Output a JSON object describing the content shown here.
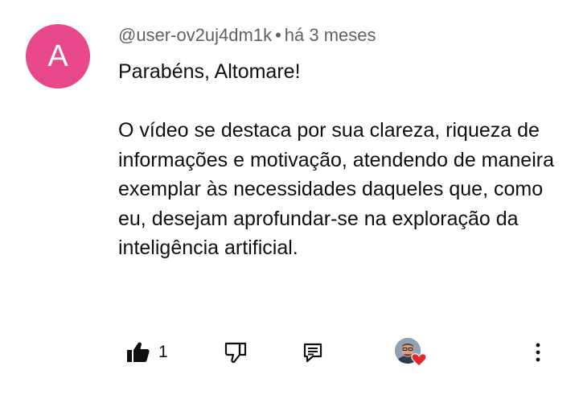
{
  "comment": {
    "avatar_letter": "A",
    "avatar_color": "#e8488a",
    "author": "@user-ov2uj4dm1k",
    "separator": "•",
    "time_ago": "há 3 meses",
    "greeting": "Parabéns, Altomare!",
    "body": "O vídeo se destaca por sua clareza, riqueza de informações e motivação, atendendo de maneira exemplar às necessidades daqueles que, como eu, desejam aprofundar-se na exploração da inteligência artificial."
  },
  "actions": {
    "like_count": "1",
    "icons": {
      "like": "thumbs-up-icon",
      "dislike": "thumbs-down-icon",
      "reply": "reply-comment-icon",
      "creator_heart": "creator-heart-badge",
      "more": "more-vert-icon"
    },
    "heart_color": "#e3262a"
  }
}
